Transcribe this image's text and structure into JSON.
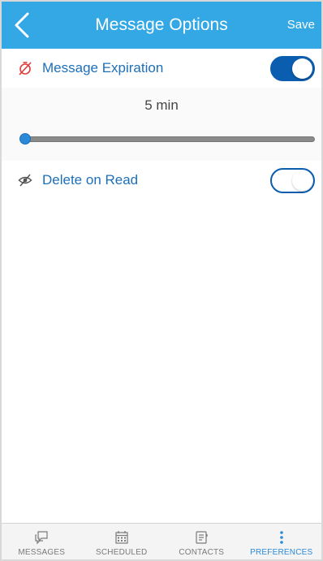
{
  "header": {
    "title": "Message Options",
    "save_label": "Save",
    "background": "#33a8e5"
  },
  "expiration": {
    "label": "Message Expiration",
    "icon": "timer-off-icon",
    "enabled": true
  },
  "slider": {
    "value_label": "5 min",
    "level": 0.0
  },
  "delete_on_read": {
    "label": "Delete on Read",
    "icon": "eye-off-icon",
    "enabled": false
  },
  "tabs": [
    {
      "label": "MESSAGES",
      "icon": "chat-bubble-icon",
      "active": false
    },
    {
      "label": "SCHEDULED",
      "icon": "calendar-icon",
      "active": false
    },
    {
      "label": "CONTACTS",
      "icon": "contacts-icon",
      "active": false
    },
    {
      "label": "PREFERENCES",
      "icon": "more-vertical-icon",
      "active": true
    }
  ],
  "colors": {
    "accent": "#1d6fb8",
    "toggle_on": "#0b5db0",
    "expiration_icon": "#e03a3a"
  }
}
